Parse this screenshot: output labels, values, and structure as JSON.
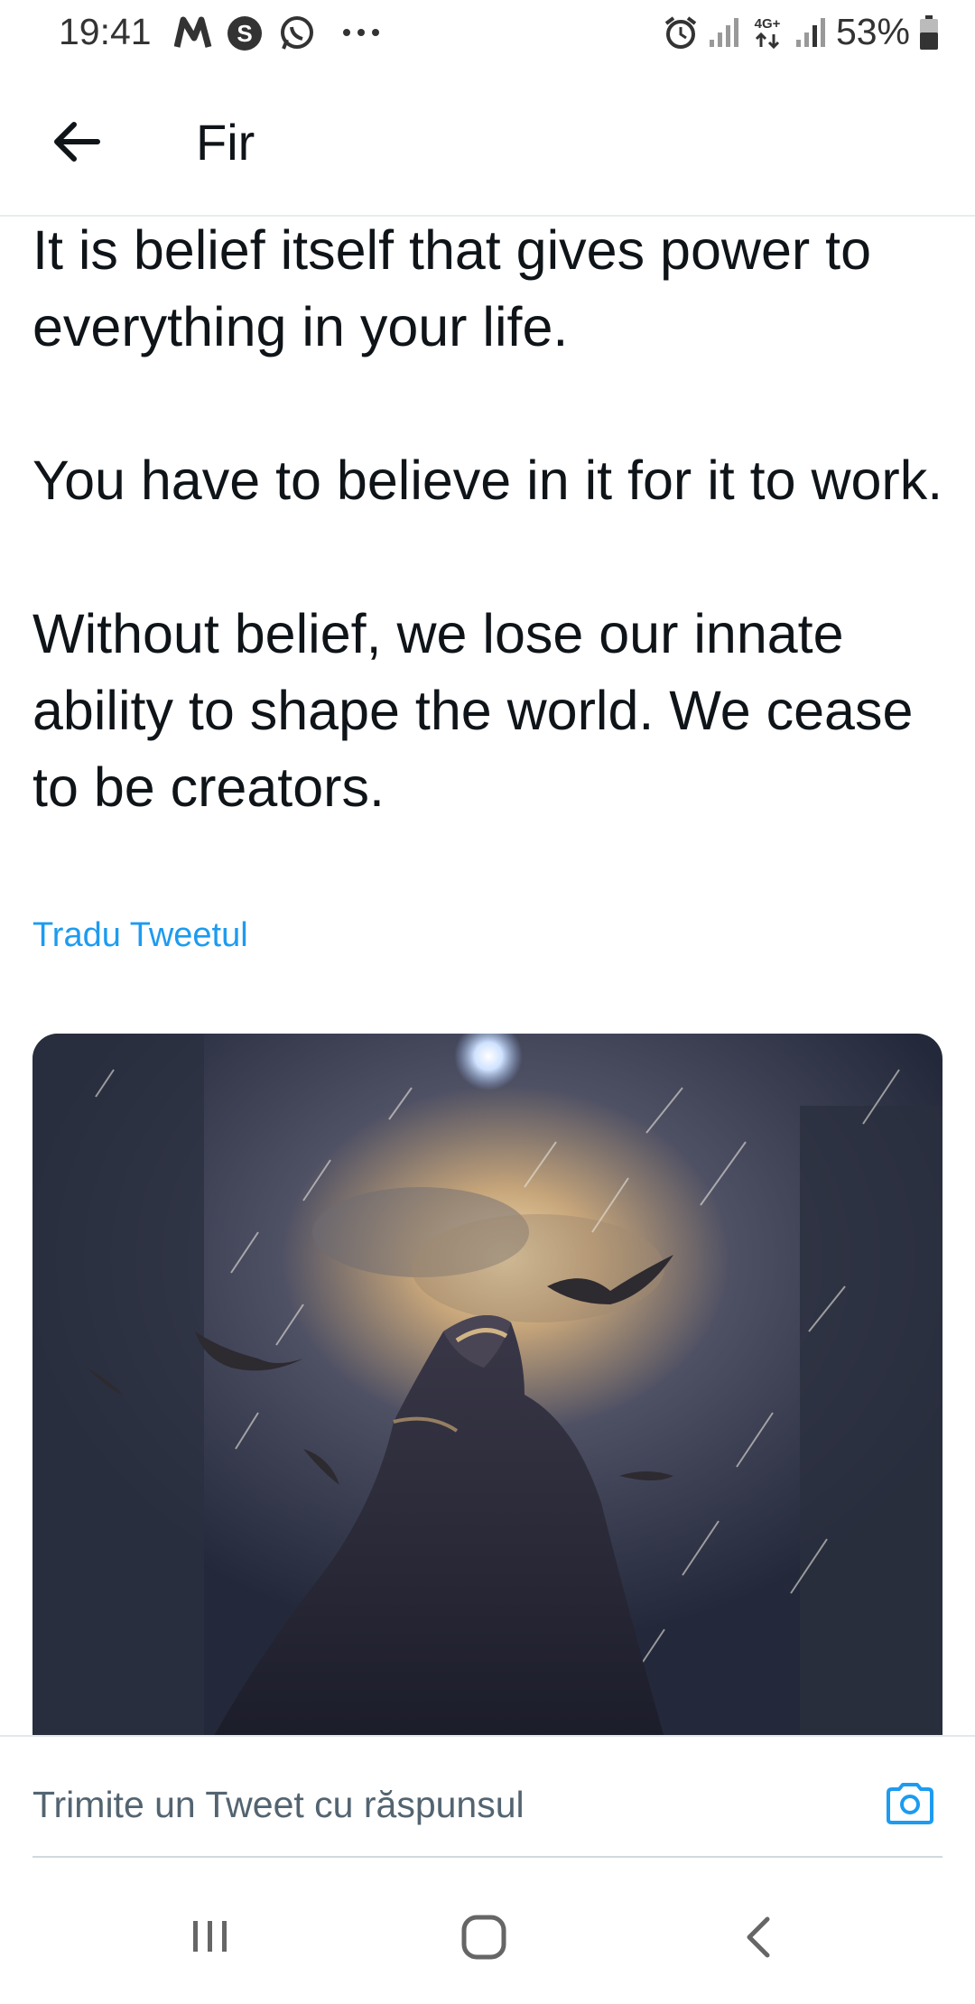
{
  "status_bar": {
    "time": "19:41",
    "battery": "53%",
    "network": "4G+",
    "icons": [
      "m-notification-icon",
      "s-notification-icon",
      "whatsapp-icon",
      "more-dots-icon",
      "alarm-icon",
      "signal-icon",
      "network-icon",
      "battery-icon"
    ]
  },
  "header": {
    "title": "Fir",
    "back_icon": "arrow-left-icon"
  },
  "tweet": {
    "paragraphs": [
      "It is belief itself that gives power to everything in your life.",
      "You have to believe in it for it to work.",
      "Without belief, we lose our innate ability to shape the world. We cease to be creators."
    ],
    "translate_label": "Tradu Tweetul"
  },
  "reply": {
    "placeholder": "Trimite un Tweet cu răspunsul",
    "camera_icon": "camera-icon"
  },
  "nav": {
    "icons": [
      "recents-icon",
      "home-icon",
      "back-icon"
    ]
  },
  "colors": {
    "accent": "#1d9bf0",
    "text": "#0f1419",
    "muted": "#536471"
  }
}
